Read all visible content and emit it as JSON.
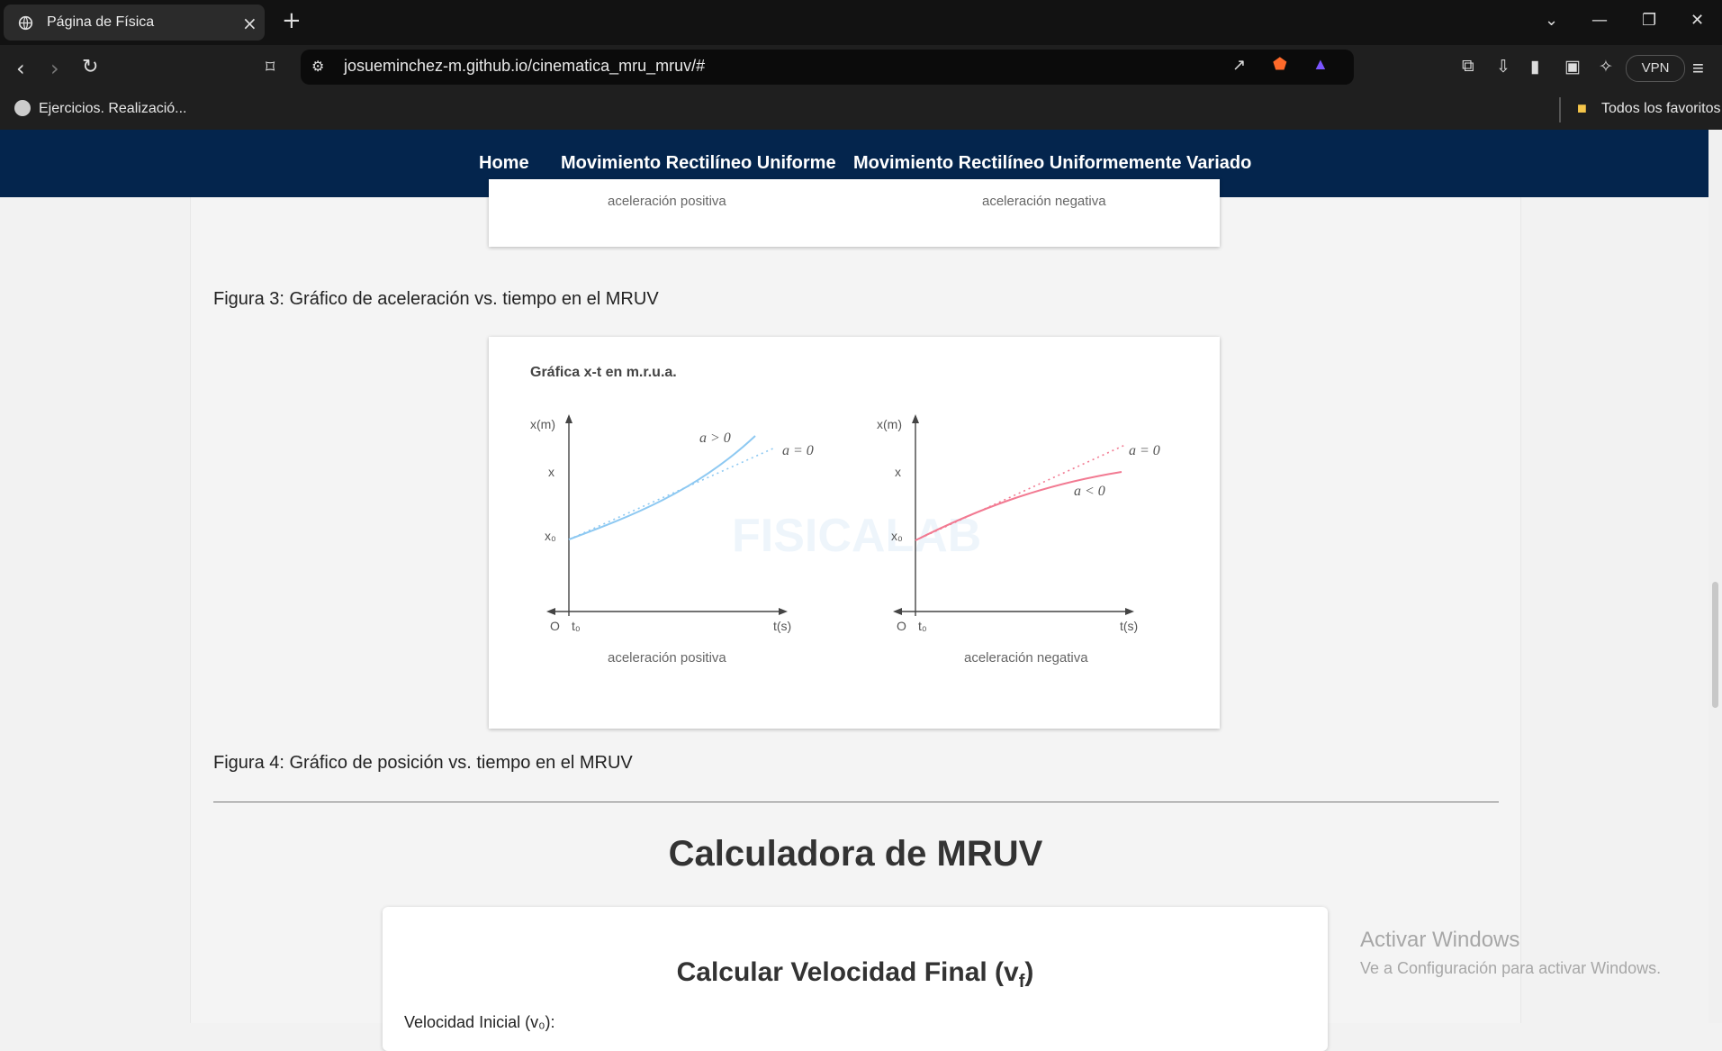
{
  "browser": {
    "tab_title": "Página de Física",
    "address": "josueminchez-m.github.io/cinematica_mru_mruv/#",
    "bookmark_item": "Ejercicios. Realizació...",
    "all_favorites": "Todos los favoritos",
    "vpn_label": "VPN",
    "icons": [
      "globe-icon",
      "close-icon",
      "plus-icon",
      "chevron-down-icon",
      "minimize-icon",
      "restore-icon",
      "back-icon",
      "forward-icon",
      "reload-icon",
      "bookmark-icon",
      "site-settings-icon",
      "share-icon",
      "brave-shield-icon",
      "brave-rewards-icon",
      "extensions-icon",
      "download-icon",
      "sidebar-icon",
      "wallet-icon",
      "leo-icon",
      "menu-icon",
      "folder-icon"
    ]
  },
  "nav": {
    "home": "Home",
    "mru": "Movimiento Rectilíneo Uniforme",
    "mruv": "Movimiento Rectilíneo Uniformemente Variado"
  },
  "figure_top": {
    "label_positive": "aceleración positiva",
    "label_negative": "aceleración negativa"
  },
  "caption_3": "Figura 3: Gráfico de aceleración vs. tiempo en el MRUV",
  "figure_4": {
    "heading": "Gráfica x-t en m.r.u.a.",
    "left_y_axis": "x(m)",
    "left_x_axis": "t(s)",
    "left_x_label": "x",
    "left_x0_label": "x₀",
    "left_origin": "O",
    "left_t0": "t₀",
    "left_curve_label": "a > 0",
    "left_dotted_label": "a = 0",
    "left_caption": "aceleración positiva",
    "right_y_axis": "x(m)",
    "right_x_axis": "t(s)",
    "right_x_label": "x",
    "right_x0_label": "x₀",
    "right_origin": "O",
    "right_t0": "t₀",
    "right_curve_label": "a < 0",
    "right_dotted_label": "a = 0",
    "right_caption": "aceleración negativa",
    "watermark": "FISICALAB"
  },
  "caption_4": "Figura 4: Gráfico de posición vs. tiempo en el MRUV",
  "calculator": {
    "title": "Calculadora de MRUV",
    "card_title_main": "Calcular Velocidad Final (v",
    "card_title_sub": "f",
    "card_title_end": ")",
    "partial_label": "Velocidad Inicial (v₀):"
  },
  "windows_watermark": {
    "line1": "Activar Windows",
    "line2": "Ve a Configuración para activar Windows."
  },
  "colors": {
    "navbar": "#04254d",
    "curve_positive": "#8ec9f2",
    "curve_negative": "#f27a92"
  }
}
